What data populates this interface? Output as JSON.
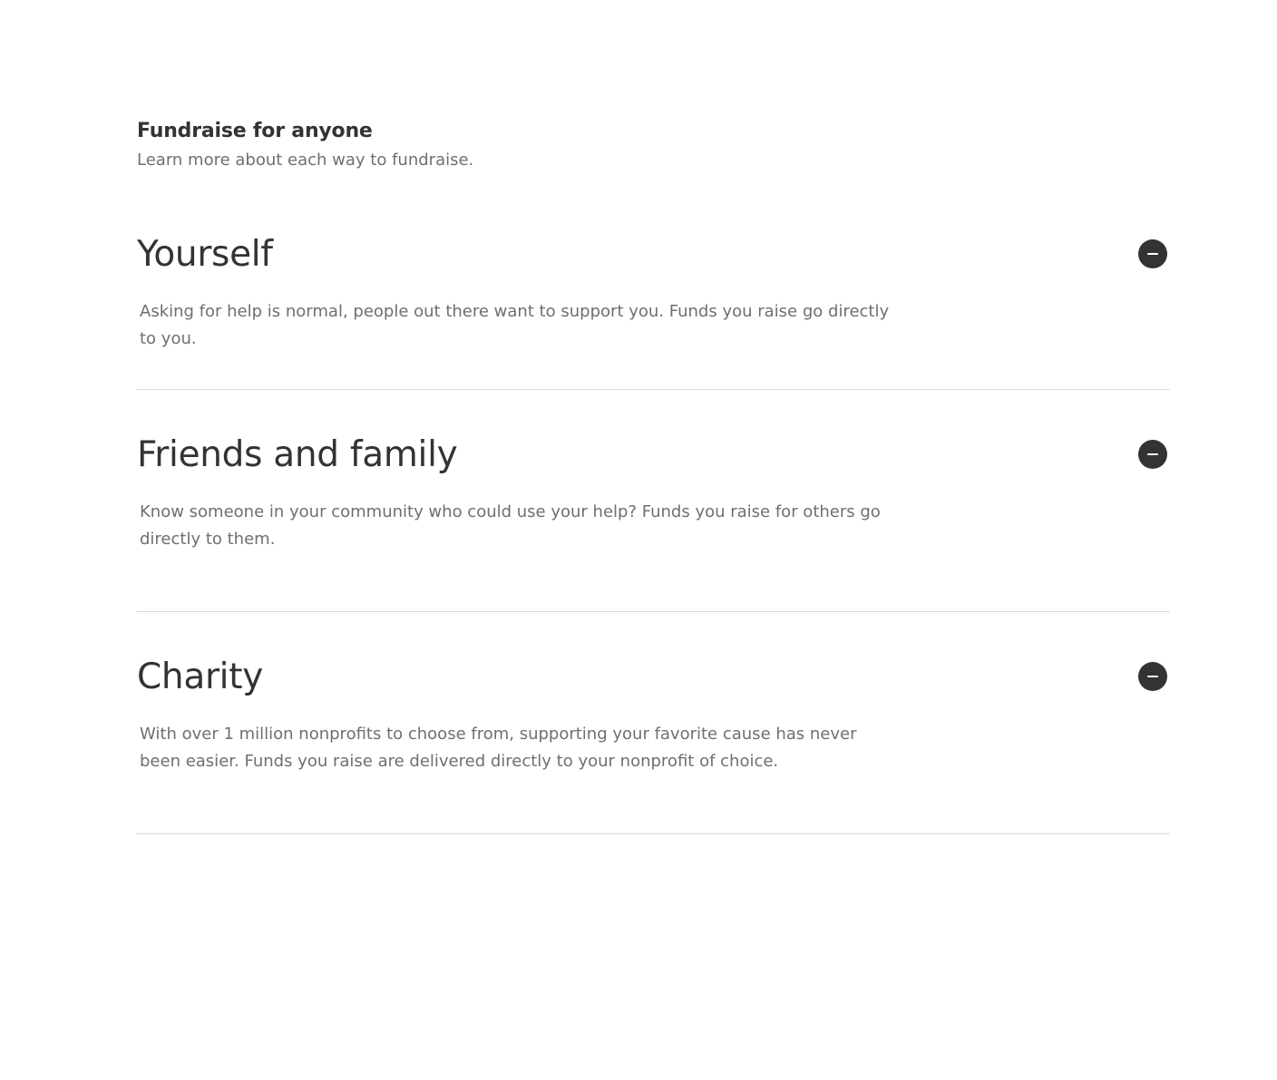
{
  "header": {
    "title": "Fundraise for anyone",
    "subtitle": "Learn more about each way to fundraise."
  },
  "accordion": {
    "items": [
      {
        "title": "Yourself",
        "body": "Asking for help is normal, people out there want to support you. Funds you raise go directly to you.",
        "expanded": true,
        "toggle_icon": "minus-icon"
      },
      {
        "title": "Friends and family",
        "body": "Know someone in your community who could use your help? Funds you raise for others go directly to them.",
        "expanded": true,
        "toggle_icon": "minus-icon"
      },
      {
        "title": "Charity",
        "body": "With over 1 million nonprofits to choose from, supporting your favorite cause has never been easier. Funds you raise are delivered directly to your nonprofit of choice.",
        "expanded": true,
        "toggle_icon": "minus-icon"
      }
    ]
  },
  "colors": {
    "text_primary": "#333333",
    "text_secondary": "#6f6f6f",
    "divider": "#d9d9d9",
    "toggle_bg": "#333333"
  }
}
